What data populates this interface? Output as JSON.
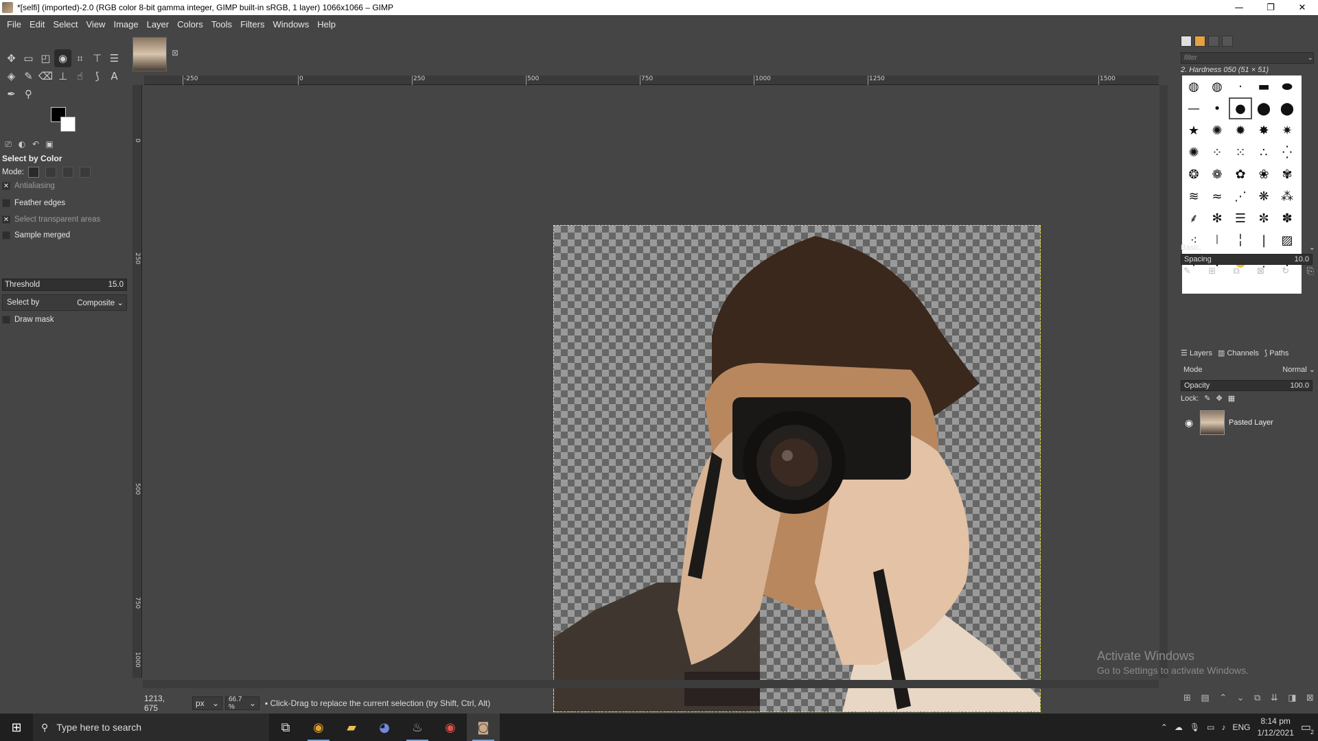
{
  "window": {
    "title": "*[selfi] (imported)-2.0 (RGB color 8-bit gamma integer, GIMP built-in sRGB, 1 layer) 1066x1066 – GIMP",
    "controls": [
      "—",
      "❐",
      "✕"
    ]
  },
  "menu": [
    "File",
    "Edit",
    "Select",
    "View",
    "Image",
    "Layer",
    "Colors",
    "Tools",
    "Filters",
    "Windows",
    "Help"
  ],
  "tool_options": {
    "title": "Select by Color",
    "mode_label": "Mode:",
    "antialiasing": "Antialiasing",
    "feather_edges": "Feather edges",
    "select_transparent": "Select transparent areas",
    "sample_merged": "Sample merged",
    "threshold_label": "Threshold",
    "threshold_value": "15.0",
    "select_by_label": "Select by",
    "select_by_value": "Composite",
    "draw_mask": "Draw mask"
  },
  "ruler": {
    "top_labels": [
      "-250",
      "0",
      "250",
      "500",
      "750",
      "1000",
      "1250",
      "1500"
    ],
    "left_labels": [
      "0",
      "250",
      "500",
      "750",
      "1000"
    ]
  },
  "status": {
    "coords": "1213, 675",
    "unit": "px",
    "zoom": "66.7 %",
    "message": "Click-Drag to replace the current selection (try Shift, Ctrl, Alt)"
  },
  "brushes": {
    "filter_placeholder": "filter",
    "current": "2. Hardness 050 (51 × 51)",
    "preset": "Basic,",
    "spacing_label": "Spacing",
    "spacing_value": "10.0"
  },
  "layers": {
    "tab_layers": "Layers",
    "tab_channels": "Channels",
    "tab_paths": "Paths",
    "mode_label": "Mode",
    "mode_value": "Normal",
    "opacity_label": "Opacity",
    "opacity_value": "100.0",
    "lock_label": "Lock:",
    "items": [
      {
        "name": "Pasted Layer"
      }
    ]
  },
  "watermark": {
    "line1": "Activate Windows",
    "line2": "Go to Settings to activate Windows."
  },
  "taskbar": {
    "search_placeholder": "Type here to search",
    "language": "ENG",
    "time": "8:14 pm",
    "date": "1/12/2021",
    "notifications": "2"
  }
}
